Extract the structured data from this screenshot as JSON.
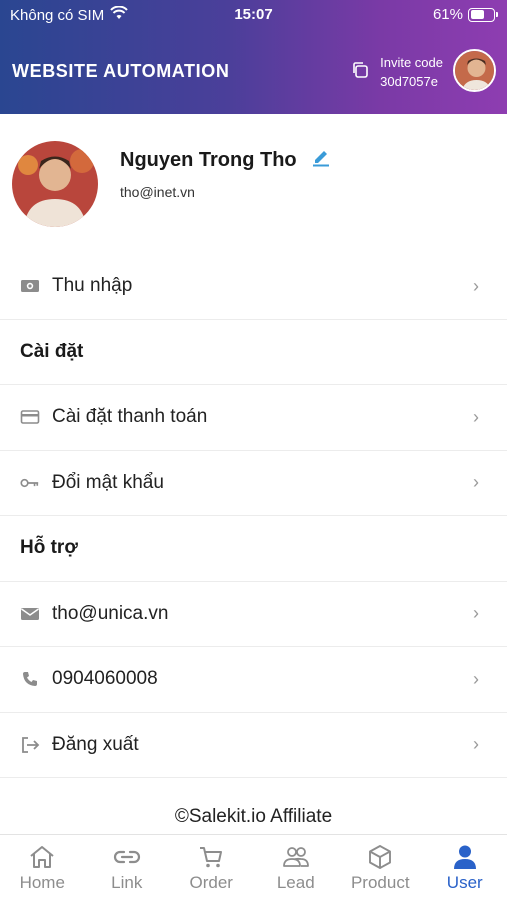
{
  "status_bar": {
    "carrier": "Không có SIM",
    "time": "15:07",
    "battery": "61%",
    "battery_level": 0.61
  },
  "header": {
    "title": "WEBSITE AUTOMATION",
    "invite_label": "Invite code",
    "invite_code": "30d7057e"
  },
  "profile": {
    "name": "Nguyen Trong Tho",
    "email": "tho@inet.vn"
  },
  "menu": {
    "income": "Thu nhập",
    "settings_section": "Cài đặt",
    "payment_settings": "Cài đặt thanh toán",
    "change_password": "Đổi mật khẩu",
    "support_section": "Hỗ trợ",
    "support_email": "tho@unica.vn",
    "support_phone": "0904060008",
    "logout": "Đăng xuất"
  },
  "footer": {
    "copyright": "©Salekit.io Affiliate"
  },
  "tabs": [
    {
      "label": "Home",
      "icon": "home-icon",
      "active": false
    },
    {
      "label": "Link",
      "icon": "link-icon",
      "active": false
    },
    {
      "label": "Order",
      "icon": "cart-icon",
      "active": false
    },
    {
      "label": "Lead",
      "icon": "users-icon",
      "active": false
    },
    {
      "label": "Product",
      "icon": "cube-icon",
      "active": false
    },
    {
      "label": "User",
      "icon": "user-icon",
      "active": true
    }
  ],
  "colors": {
    "accent": "#2a62c9",
    "header_start": "#2a4691",
    "header_end": "#8e3db1"
  }
}
